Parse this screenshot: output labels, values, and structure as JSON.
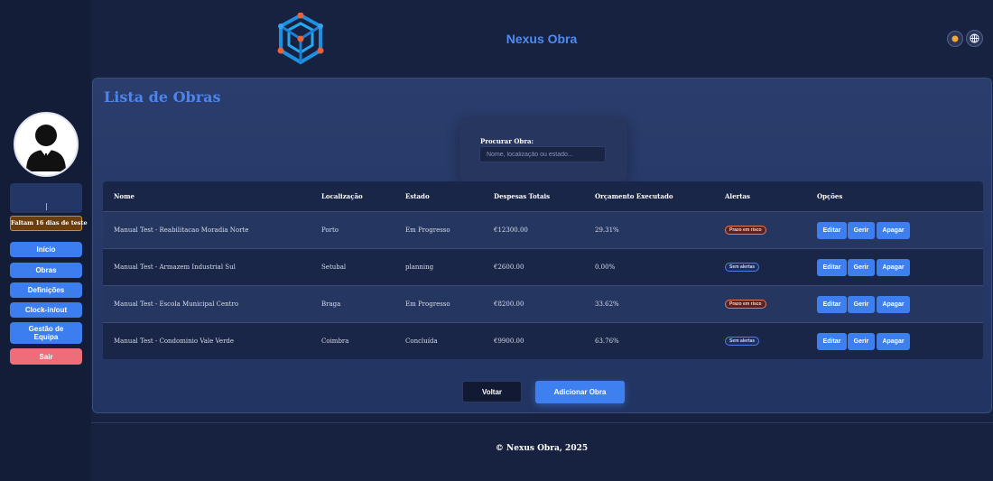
{
  "app": {
    "title": "Nexus Obra"
  },
  "sidebar": {
    "trial_badge": "Faltam 16 dias de teste",
    "items": [
      {
        "label": "Início"
      },
      {
        "label": "Obras"
      },
      {
        "label": "Definições"
      },
      {
        "label": "Clock-in/out"
      },
      {
        "label": "Gestão de Equipa"
      },
      {
        "label": "Sair"
      }
    ]
  },
  "page": {
    "title": "Lista de Obras"
  },
  "search": {
    "label": "Procurar Obra:",
    "placeholder": "Nome, localização ou estado..."
  },
  "table": {
    "headers": [
      "Nome",
      "Localização",
      "Estado",
      "Despesas Totais",
      "Orçamento Executado",
      "Alertas",
      "Opções"
    ],
    "rows": [
      {
        "name": "Manual Test - Reabilitacao Moradia Norte",
        "location": "Porto",
        "status": "Em Progresso",
        "expenses": "€12300.00",
        "budget": "29.31%",
        "alert": "Prazo em risco",
        "alert_type": "risk"
      },
      {
        "name": "Manual Test - Armazem Industrial Sul",
        "location": "Setubal",
        "status": "planning",
        "expenses": "€2600.00",
        "budget": "0.00%",
        "alert": "Sem alertas",
        "alert_type": "none"
      },
      {
        "name": "Manual Test - Escola Municipal Centro",
        "location": "Braga",
        "status": "Em Progresso",
        "expenses": "€8200.00",
        "budget": "33.62%",
        "alert": "Prazo em risco",
        "alert_type": "risk"
      },
      {
        "name": "Manual Test - Condominio Vale Verde",
        "location": "Coimbra",
        "status": "Concluída",
        "expenses": "€9900.00",
        "budget": "63.76%",
        "alert": "Sem alertas",
        "alert_type": "none"
      }
    ],
    "row_actions": {
      "edit": "Editar",
      "manage": "Gerir",
      "delete": "Apagar"
    }
  },
  "actions": {
    "back": "Voltar",
    "add": "Adicionar Obra"
  },
  "footer": {
    "text": "© Nexus Obra, 2025"
  },
  "colors": {
    "accent": "#3e7ff0",
    "background": "#172241",
    "danger": "#ef6d78",
    "warning": "#d08a34"
  },
  "icons": {
    "header_left": "sun-icon",
    "header_right": "globe-icon",
    "logo": "cube-logo"
  }
}
